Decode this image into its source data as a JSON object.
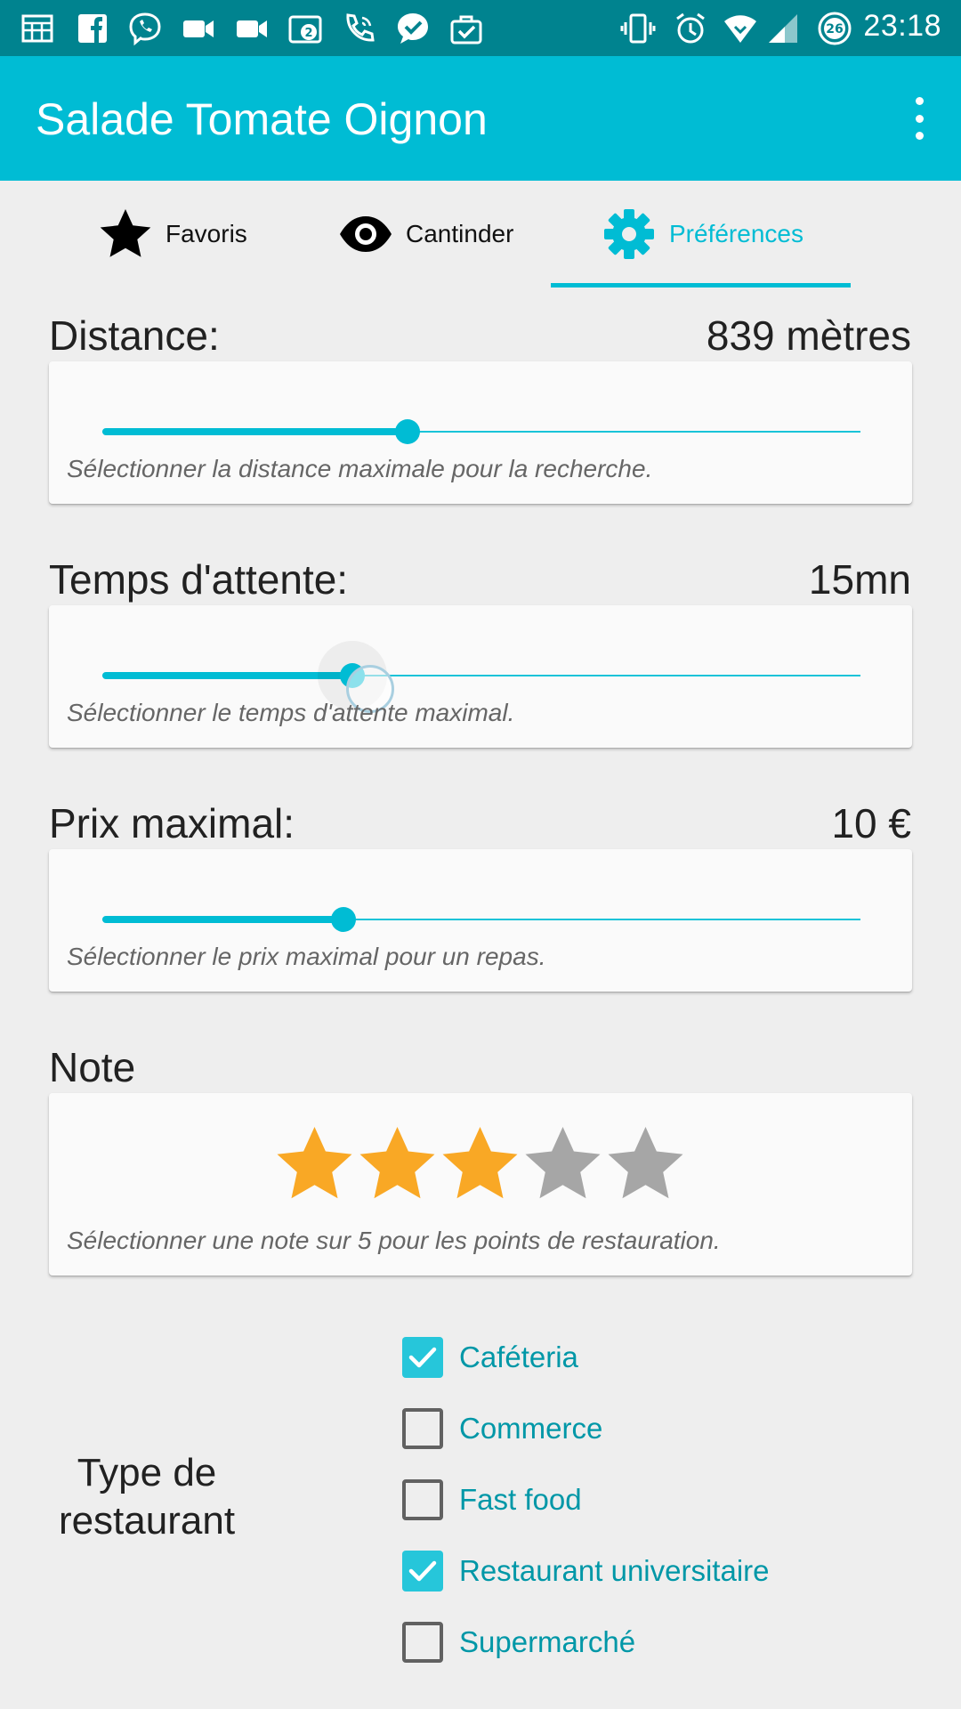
{
  "status_bar": {
    "time": "23:18",
    "notification_icons": [
      "calendar-icon",
      "facebook-icon",
      "viber-icon",
      "video-call-icon",
      "video-camera-icon",
      "photo-badge-icon",
      "phone-call-icon",
      "check-chat-icon",
      "briefcase-check-icon"
    ],
    "photo_badge_count": "2",
    "battery_level": "26",
    "system_icons": [
      "vibrate-icon",
      "alarm-icon",
      "wifi-icon",
      "signal-icon",
      "battery-icon"
    ]
  },
  "app_bar": {
    "title": "Salade Tomate Oignon",
    "menu_icon": "overflow-menu-icon"
  },
  "tabs": [
    {
      "label": "Favoris",
      "icon": "star-icon",
      "active": false
    },
    {
      "label": "Cantinder",
      "icon": "eye-icon",
      "active": false
    },
    {
      "label": "Préférences",
      "icon": "gear-icon",
      "active": true
    }
  ],
  "colors": {
    "accent": "#00bcd4",
    "status_bar": "#00838f",
    "star_filled": "#f9a825",
    "star_empty": "#a6a6a6",
    "checkbox_label": "#0097a7"
  },
  "distance": {
    "title": "Distance:",
    "value": "839 mètres",
    "slider_fraction": 0.403,
    "description": "Sélectionner la distance maximale pour la recherche."
  },
  "waiting_time": {
    "title": "Temps d'attente:",
    "value": "15mn",
    "slider_fraction": 0.33,
    "description": "Sélectionner le temps d'attente maximal."
  },
  "max_price": {
    "title": "Prix maximal:",
    "value": "10 €",
    "slider_fraction": 0.318,
    "description": "Sélectionner le prix maximal pour un repas."
  },
  "rating": {
    "title": "Note",
    "value": 3,
    "max": 5,
    "description": "Sélectionner une note sur 5 pour les points de restauration."
  },
  "restaurant_type": {
    "label": "Type de restaurant",
    "options": [
      {
        "label": "Caféteria",
        "checked": true
      },
      {
        "label": "Commerce",
        "checked": false
      },
      {
        "label": "Fast food",
        "checked": false
      },
      {
        "label": "Restaurant universitaire",
        "checked": true
      },
      {
        "label": "Supermarché",
        "checked": false
      }
    ]
  }
}
